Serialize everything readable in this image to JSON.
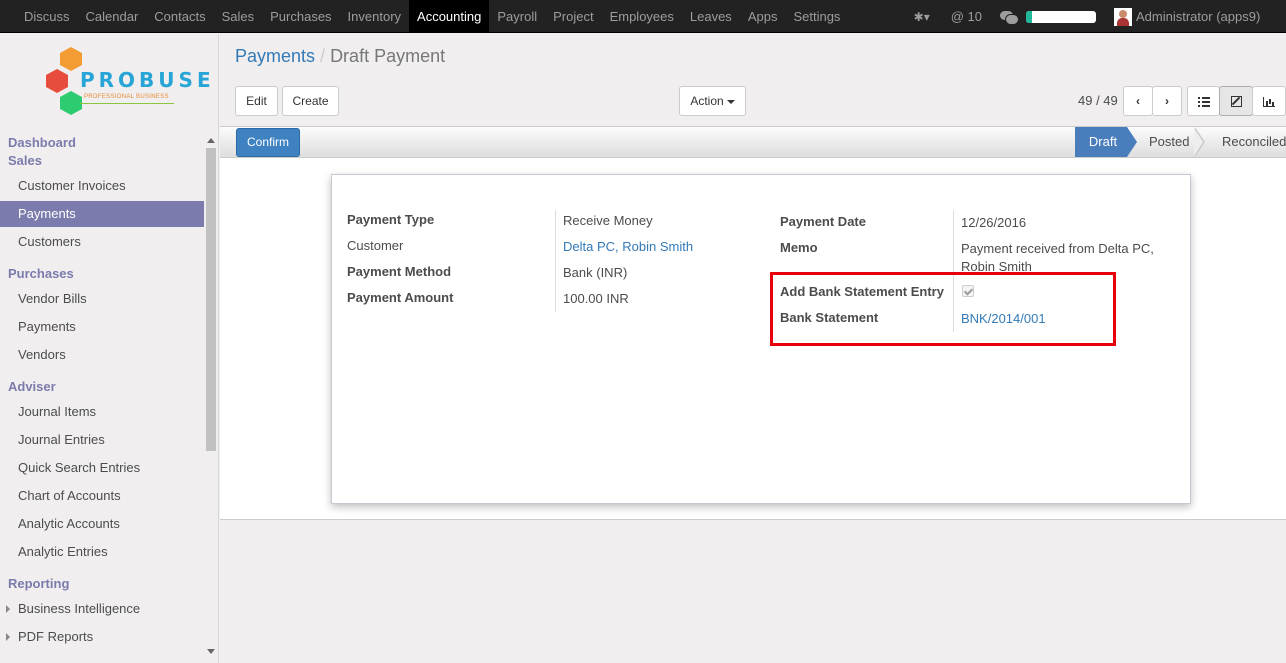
{
  "topnav": {
    "menu": [
      "Discuss",
      "Calendar",
      "Contacts",
      "Sales",
      "Purchases",
      "Inventory",
      "Accounting",
      "Payroll",
      "Project",
      "Employees",
      "Leaves",
      "Apps",
      "Settings"
    ],
    "active": "Accounting",
    "mentions_label": "@ 10",
    "progress_fraction": 0.08,
    "user": "Administrator (apps9)"
  },
  "logo": {
    "word": "PROBUSE",
    "tagline": "PROFESSIONAL BUSINESS"
  },
  "sidebar": {
    "sections": [
      {
        "title": "Dashboard"
      },
      {
        "title": "Sales",
        "items": [
          "Customer Invoices",
          "Payments",
          "Customers"
        ]
      },
      {
        "title": "Purchases",
        "items": [
          "Vendor Bills",
          "Payments",
          "Vendors"
        ]
      },
      {
        "title": "Adviser",
        "items": [
          "Journal Items",
          "Journal Entries",
          "Quick Search Entries",
          "Chart of Accounts",
          "Analytic Accounts",
          "Analytic Entries"
        ]
      },
      {
        "title": "Reporting",
        "items": [
          "Business Intelligence",
          "PDF Reports"
        ]
      }
    ],
    "active_item": "Payments"
  },
  "breadcrumb": {
    "parent": "Payments",
    "separator": "/",
    "current": "Draft Payment"
  },
  "buttons": {
    "edit": "Edit",
    "create": "Create",
    "action": "Action"
  },
  "pager": {
    "label": "49 / 49"
  },
  "statusbar": {
    "confirm": "Confirm",
    "stages": [
      "Draft",
      "Posted",
      "Reconciled"
    ],
    "current_stage": "Draft"
  },
  "form": {
    "left": [
      {
        "label": "Payment Type",
        "value": "Receive Money"
      },
      {
        "label": "Customer",
        "value": "Delta PC, Robin Smith"
      },
      {
        "label": "Payment Method",
        "value": "Bank (INR)"
      },
      {
        "label": "Payment Amount",
        "value": "100.00",
        "currency": "INR"
      }
    ],
    "right": [
      {
        "label": "Payment Date",
        "value": "12/26/2016"
      },
      {
        "label": "Memo",
        "value_line1": "Payment received from Delta PC,",
        "value_line2": "Robin Smith"
      },
      {
        "label": "Add Bank Statement Entry",
        "checked": true
      },
      {
        "label": "Bank Statement",
        "value": "BNK/2014/001"
      }
    ]
  },
  "colors": {
    "accent": "#7c7bad",
    "link": "#337ab7",
    "primary": "#3e82c1",
    "highlight_box": "#e8000b"
  }
}
